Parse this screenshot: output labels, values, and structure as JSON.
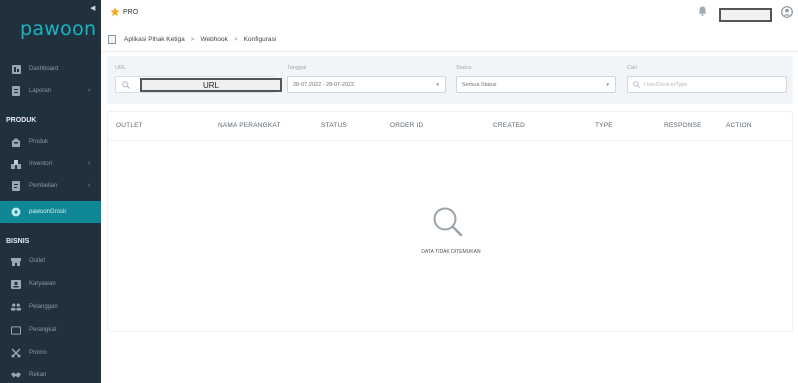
{
  "sidebar": {
    "logo": "pawoon",
    "top_items": [
      {
        "label": "Dashboard",
        "icon": "dashboard-icon"
      },
      {
        "label": "Laporan",
        "icon": "report-icon"
      }
    ],
    "section_produk": "PRODUK",
    "produk_items": [
      {
        "label": "Produk",
        "icon": "product-icon"
      },
      {
        "label": "Inventori",
        "icon": "inventory-icon"
      },
      {
        "label": "Pembelian",
        "icon": "purchase-icon"
      },
      {
        "label": "pawoonGrosir",
        "icon": "grosir-icon"
      }
    ],
    "section_bisnis": "BISNIS",
    "bisnis_items": [
      {
        "label": "Outlet",
        "icon": "outlet-icon"
      },
      {
        "label": "Karyawan",
        "icon": "employee-icon"
      },
      {
        "label": "Pelanggan",
        "icon": "customer-icon"
      },
      {
        "label": "Perangkat",
        "icon": "device-icon"
      },
      {
        "label": "Promo",
        "icon": "promo-icon"
      },
      {
        "label": "Rekan",
        "icon": "handshake-icon"
      }
    ]
  },
  "topbar": {
    "plan_label": "PRO",
    "user_name": ""
  },
  "breadcrumb": [
    "Aplikasi Pihak Ketiga",
    "Webhook",
    "Konfigurasi"
  ],
  "filters": {
    "url_label": "URL",
    "url_value": "URL",
    "tanggal_label": "Tanggal",
    "tanggal_value": "28-07-2022 - 28-07-2022",
    "status_label": "Status",
    "status_value": "Semua Status",
    "cari_label": "Cari",
    "cari_placeholder": "User/Device/Type"
  },
  "table": {
    "columns": [
      "OUTLET",
      "NAMA PERANGKAT",
      "STATUS",
      "ORDER ID",
      "CREATED",
      "TYPE",
      "RESPONSE",
      "ACTION"
    ],
    "empty_text": "DATA TIDAK DITEMUKAN"
  },
  "colors": {
    "sidebar_bg": "#20303d",
    "accent": "#0f8797",
    "logo": "#19b5c5",
    "star": "#f5a623"
  }
}
